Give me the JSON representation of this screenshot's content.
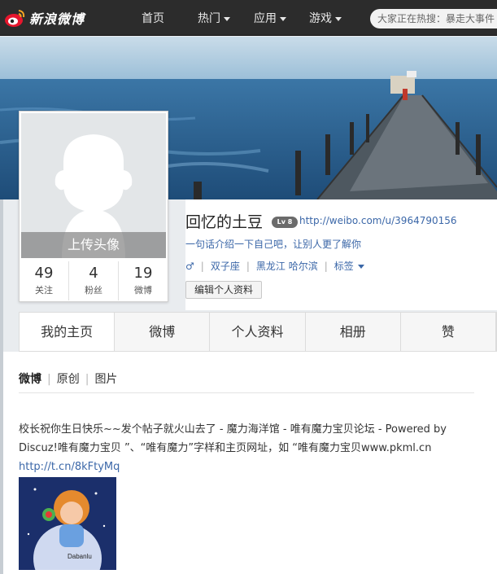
{
  "topnav": {
    "logo_text": "新浪微博",
    "items": [
      {
        "label": "首页",
        "dropdown": false
      },
      {
        "label": "热门",
        "dropdown": true
      },
      {
        "label": "应用",
        "dropdown": true
      },
      {
        "label": "游戏",
        "dropdown": true
      }
    ],
    "search_placeholder": "大家正在热搜：暴走大事件"
  },
  "avatar": {
    "upload_label": "上传头像"
  },
  "stats": [
    {
      "value": "49",
      "label": "关注"
    },
    {
      "value": "4",
      "label": "粉丝"
    },
    {
      "value": "19",
      "label": "微博"
    }
  ],
  "profile": {
    "name": "回忆的土豆",
    "level_badge": "Lv 8",
    "url": "http://weibo.com/u/3964790156",
    "intro": "一句话介绍一下自己吧，让别人更了解你",
    "gender_icon": "♂",
    "sign": "双子座",
    "location": "黑龙江 哈尔滨",
    "tags_label": "标签",
    "edit_button": "编辑个人资料"
  },
  "tabs": [
    {
      "label": "我的主页",
      "active": true
    },
    {
      "label": "微博",
      "active": false
    },
    {
      "label": "个人资料",
      "active": false
    },
    {
      "label": "相册",
      "active": false
    },
    {
      "label": "赞",
      "active": false
    }
  ],
  "subtabs": [
    {
      "label": "微博",
      "active": true
    },
    {
      "label": "原创",
      "active": false
    },
    {
      "label": "图片",
      "active": false
    }
  ],
  "post": {
    "text": "校长祝你生日快乐~~发个帖子就火山去了 - 魔力海洋馆 - 唯有魔力宝贝论坛 - Powered by Discuz!唯有魔力宝贝 ”、“唯有魔力”字样和主页网址，如 “唯有魔力宝贝www.pkml.cn",
    "link": "http://t.cn/8kFtyMq",
    "image_caption": "Dabanlu"
  },
  "colors": {
    "nav_bg": "#2c2c2c",
    "link": "#3b67a8",
    "sea": "#2c5f8c"
  }
}
